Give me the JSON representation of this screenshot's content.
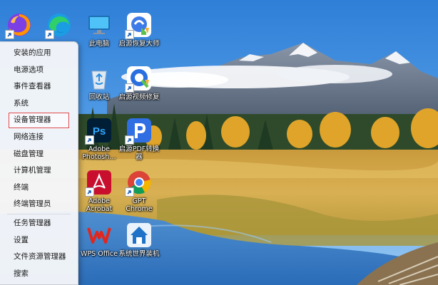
{
  "menu": {
    "items": [
      {
        "label": "安装的应用"
      },
      {
        "label": "电源选项"
      },
      {
        "label": "事件查看器"
      },
      {
        "label": "系统"
      },
      {
        "label": "设备管理器",
        "highlighted": true
      },
      {
        "label": "网络连接"
      },
      {
        "label": "磁盘管理"
      },
      {
        "label": "计算机管理"
      },
      {
        "label": "终端"
      },
      {
        "label": "终端管理员"
      },
      {
        "label": "任务管理器"
      },
      {
        "label": "设置"
      },
      {
        "label": "文件资源管理器"
      },
      {
        "label": "搜索"
      }
    ]
  },
  "desktop": {
    "icons": [
      {
        "name": "firefox",
        "label": "",
        "icon": "firefox-icon"
      },
      {
        "name": "edge",
        "label": "",
        "icon": "edge-icon"
      },
      {
        "name": "this-pc",
        "label": "此电脑",
        "icon": "monitor-icon"
      },
      {
        "name": "recover-software",
        "label": "启源恢复大师",
        "icon": "recover-app-icon"
      },
      {
        "name": "recycle-bin",
        "label": "回收站",
        "icon": "recycle-bin-icon"
      },
      {
        "name": "recover-video",
        "label": "启源视频修复",
        "icon": "video-repair-icon"
      },
      {
        "name": "photoshop",
        "label": "Adobe\nPhotosh…",
        "icon": "photoshop-icon"
      },
      {
        "name": "pdf-converter",
        "label": "启源PDF转换\n器",
        "icon": "pdf-converter-icon"
      },
      {
        "name": "acrobat",
        "label": "Adobe\nAcrobat",
        "icon": "acrobat-icon"
      },
      {
        "name": "chrome",
        "label": "GPT\nChrome",
        "icon": "chrome-icon"
      },
      {
        "name": "wps",
        "label": "WPS Office",
        "icon": "wps-icon"
      },
      {
        "name": "system-installer",
        "label": "系统世界装机",
        "icon": "installer-icon"
      }
    ]
  },
  "colors": {
    "sky": "#3f8bdf",
    "menu_bg": "#f4f6f9",
    "highlight_border": "#d8474b"
  }
}
